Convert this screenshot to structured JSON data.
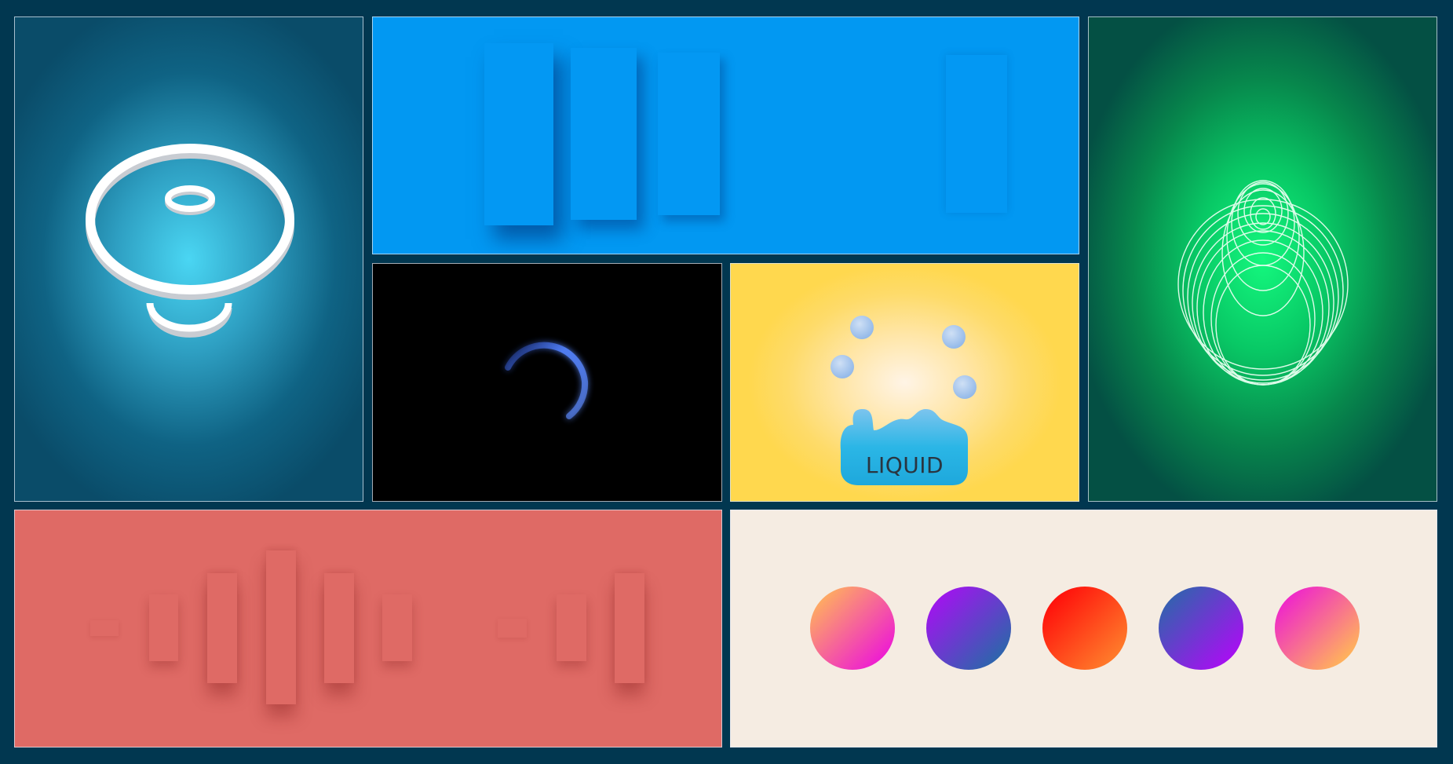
{
  "panels": {
    "rings": {
      "icon": "ring-stack-icon"
    },
    "bars": {
      "icon": "shadow-bars-icon"
    },
    "green": {
      "icon": "orbit-rings-icon"
    },
    "spinner": {
      "icon": "spinner-arc-icon",
      "arc_color": "#4f7cf0"
    },
    "liquid": {
      "label": "LIQUID",
      "icon": "liquid-blob-icon"
    },
    "equalizer": {
      "icon": "equalizer-bars-icon"
    },
    "dots": {
      "icon": "gradient-dots-icon",
      "items": [
        {
          "from": "#ffb25c",
          "to": "#ee1fd0"
        },
        {
          "from": "#a511f0",
          "to": "#2f64ad"
        },
        {
          "from": "#ff0a0a",
          "to": "#ff7a2a"
        },
        {
          "from": "#2f64ad",
          "to": "#a511f0"
        },
        {
          "from": "#ee1fd0",
          "to": "#ffb25c"
        }
      ]
    }
  },
  "colors": {
    "page_bg": "#013750",
    "bars_bg": "#0298f2",
    "equalizer_bg": "#df6a65",
    "dots_bg": "#f5ece2",
    "liquid_blob": "#2bb6e6"
  }
}
